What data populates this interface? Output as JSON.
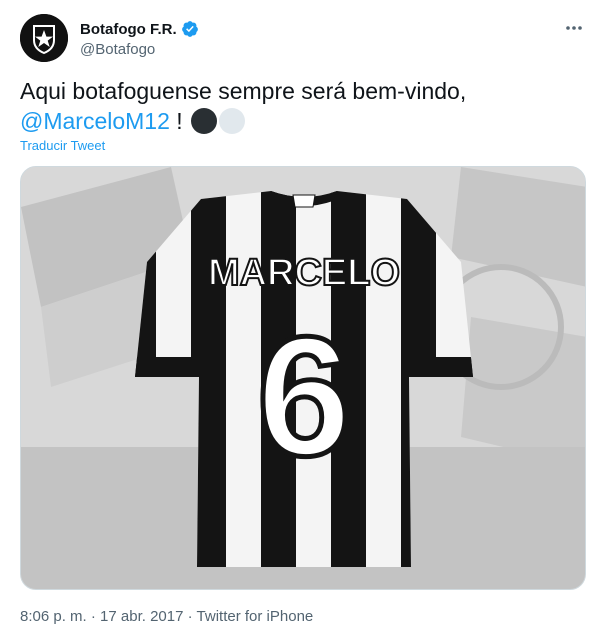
{
  "author": {
    "display_name": "Botafogo F.R.",
    "handle": "@Botafogo",
    "verified": true,
    "avatar_icon": "botafogo-star-crest-icon"
  },
  "tweet": {
    "text": "Aqui botafoguense sempre será bem-vindo,",
    "mention": "@MarceloM12",
    "suffix": " !",
    "emoji": [
      "black-circle",
      "white-circle"
    ],
    "translate_label": "Traducir Tweet"
  },
  "media": {
    "jersey_name": "MARCELO",
    "jersey_number": "6"
  },
  "meta": {
    "time": "8:06 p. m.",
    "date": "17 abr. 2017",
    "source": "Twitter for iPhone",
    "separator": " · "
  },
  "colors": {
    "link": "#1d9bf0",
    "text": "#0f1419",
    "muted": "#536471",
    "jersey_black": "#141414"
  }
}
